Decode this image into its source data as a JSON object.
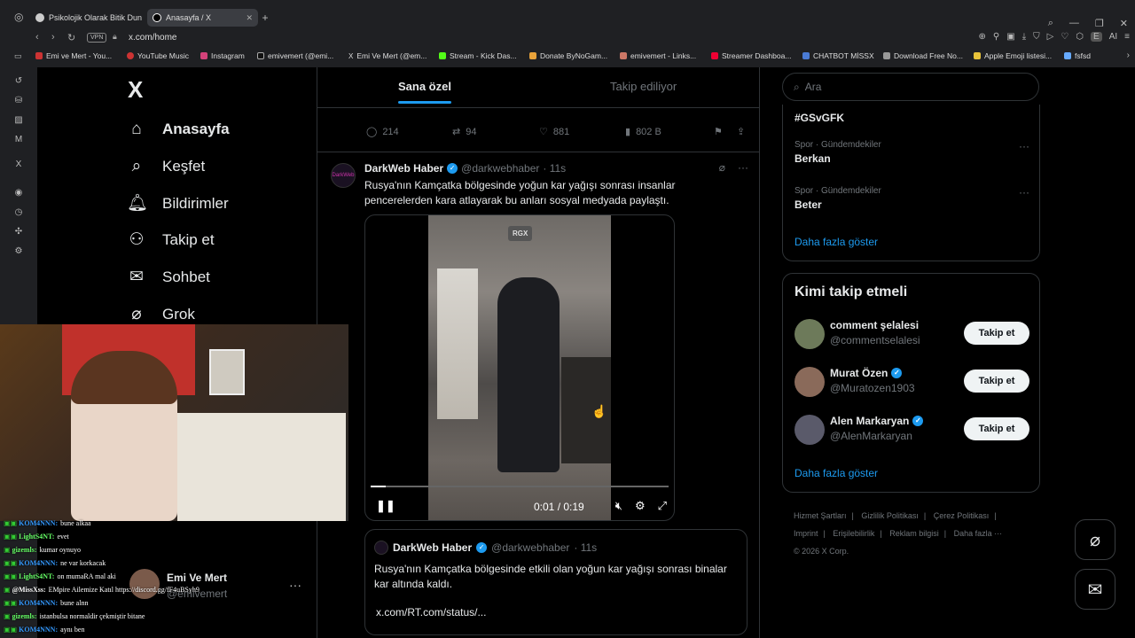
{
  "browser": {
    "tabs": [
      {
        "label": "Psikolojik Olarak Bitik Dun"
      },
      {
        "label": "Anasayfa / X"
      }
    ],
    "new_tab": "+",
    "url": "x.com/home",
    "vpn": "VPN",
    "bookmarks": [
      {
        "label": "Emi ve Mert - You..."
      },
      {
        "label": "YouTube Music"
      },
      {
        "label": "Instagram"
      },
      {
        "label": "emivemert (@emi..."
      },
      {
        "label": "Emi Ve Mert (@em..."
      },
      {
        "label": "Stream - Kick Das..."
      },
      {
        "label": "Donate ByNoGam..."
      },
      {
        "label": "emivemert - Links..."
      },
      {
        "label": "Streamer Dashboa..."
      },
      {
        "label": "CHATBOT MİSSX"
      },
      {
        "label": "Download Free No..."
      },
      {
        "label": "Apple Emoji listesi..."
      },
      {
        "label": "fsfsd"
      }
    ],
    "ai_label": "AI"
  },
  "x_nav": {
    "logo": "X",
    "items": [
      {
        "label": "Anasayfa",
        "icon": "home-icon"
      },
      {
        "label": "Keşfet",
        "icon": "search-icon"
      },
      {
        "label": "Bildirimler",
        "icon": "bell-icon"
      },
      {
        "label": "Takip et",
        "icon": "follow-icon"
      },
      {
        "label": "Sohbet",
        "icon": "mail-icon"
      },
      {
        "label": "Grok",
        "icon": "grok-icon"
      }
    ]
  },
  "feed": {
    "tab_for_you": "Sana özel",
    "tab_following": "Takip ediliyor",
    "prev_tweet_stats": {
      "replies": "214",
      "retweets": "94",
      "likes": "881",
      "views": "802 B"
    },
    "tweet": {
      "avatar_text": "DarkWeb",
      "name": "DarkWeb Haber",
      "handle": "@darkwebhaber",
      "time": "· 11s",
      "text": "Rusya'nın Kamçatka bölgesinde yoğun kar yağışı sonrası insanlar pencerelerden kara atlayarak bu anları sosyal medyada paylaştı.",
      "video": {
        "logo": "RGX",
        "time": "0:01 / 0:19",
        "progress": 0.05
      }
    },
    "quote": {
      "name": "DarkWeb Haber",
      "handle": "@darkwebhaber",
      "time": "· 11s",
      "text": "Rusya'nın Kamçatka bölgesinde etkili olan yoğun kar yağışı sonrası binalar kar altında kaldı.",
      "link": "x.com/RT.com/status/..."
    }
  },
  "right": {
    "search_placeholder": "Ara",
    "trends": [
      {
        "category": "",
        "name": "#GSvGFK"
      },
      {
        "category": "Spor · Gündemdekiler",
        "name": "Berkan"
      },
      {
        "category": "Spor · Gündemdekiler",
        "name": "Beter"
      }
    ],
    "trends_more": "Daha fazla göster",
    "who_to_follow_title": "Kimi takip etmeli",
    "who_to_follow": [
      {
        "name": "comment şelalesi",
        "handle": "@commentselalesi",
        "verified": false,
        "button": "Takip et"
      },
      {
        "name": "Murat Özen",
        "handle": "@Muratozen1903",
        "verified": true,
        "button": "Takip et"
      },
      {
        "name": "Alen Markaryan",
        "handle": "@AlenMarkaryan",
        "verified": true,
        "button": "Takip et"
      }
    ],
    "who_more": "Daha fazla göster",
    "footer": [
      "Hizmet Şartları",
      "|",
      "Gizlilik Politikası",
      "|",
      "Çerez Politikası",
      "|",
      "Imprint",
      "|",
      "Erişilebilirlik",
      "|",
      "Reklam bilgisi",
      "|",
      "Daha fazla ···",
      "© 2026 X Corp."
    ]
  },
  "overlay": {
    "account_name": "Emi Ve Mert",
    "account_handle": "@emivemert",
    "more": "···",
    "chat": [
      {
        "user": "KOM4NNN:",
        "msg": "bune alkaa"
      },
      {
        "user": "LightS4NT:",
        "msg": "evet"
      },
      {
        "user": "gizemls:",
        "msg": "kumar oynuyo"
      },
      {
        "user": "KOM4NNN:",
        "msg": "ne var korkacak"
      },
      {
        "user": "LightS4NT:",
        "msg": "on mumaRA mal aki"
      },
      {
        "user": "@MissXss:",
        "msg": "EMpire Ailemize Katıl https://discord.gg/fF4uBSyh9"
      },
      {
        "user": "KOM4NNN:",
        "msg": "bune alnn"
      },
      {
        "user": "gizemls:",
        "msg": "istanbulsa normaldir çekmiştir bitane"
      },
      {
        "user": "KOM4NNN:",
        "msg": "aynı ben"
      }
    ]
  },
  "colors": {
    "accent": "#1d9bf0",
    "bg": "#000000",
    "border": "#2f3336",
    "muted": "#71767b"
  }
}
